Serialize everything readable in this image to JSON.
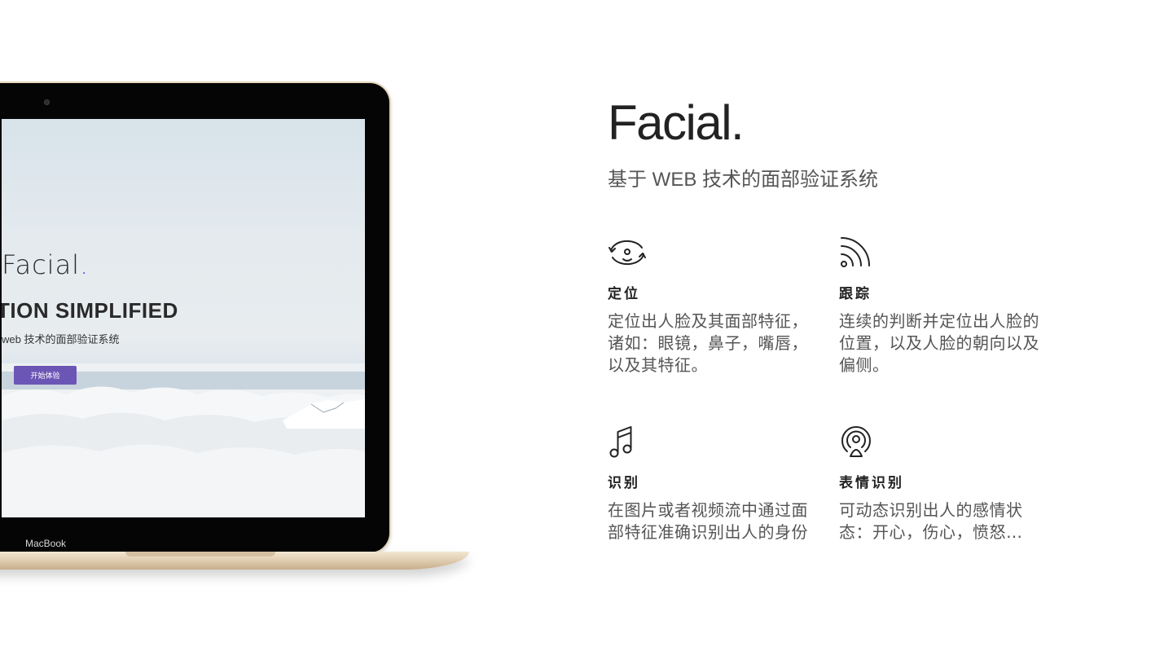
{
  "mockup": {
    "screen": {
      "brand": "Facial",
      "brand_dot": ".",
      "headline": "TION SIMPLIFIED",
      "subtitle": "web 技术的面部验证系统",
      "button_label": "开始体验",
      "accent_color": "#7b3fe4",
      "button_color": "#6c56b5"
    },
    "chin_label": "MacBook"
  },
  "hero": {
    "title": "Facial.",
    "subtitle": "基于 WEB 技术的面部验证系统"
  },
  "features": [
    {
      "icon": "rotate-face-icon",
      "title": "定位",
      "description": "定位出人脸及其面部特征，诸如：眼镜，鼻子，嘴唇，以及其特征。"
    },
    {
      "icon": "signal-tracking-icon",
      "title": "跟踪",
      "description": "连续的判断并定位出人脸的位置，以及人脸的朝向以及偏侧。"
    },
    {
      "icon": "music-note-icon",
      "title": "识别",
      "description": "在图片或者视频流中通过面部特征准确识别出人的身份"
    },
    {
      "icon": "podcast-icon",
      "title": "表情识别",
      "description": "可动态识别出人的感情状态：开心，伤心，愤怒…"
    }
  ]
}
